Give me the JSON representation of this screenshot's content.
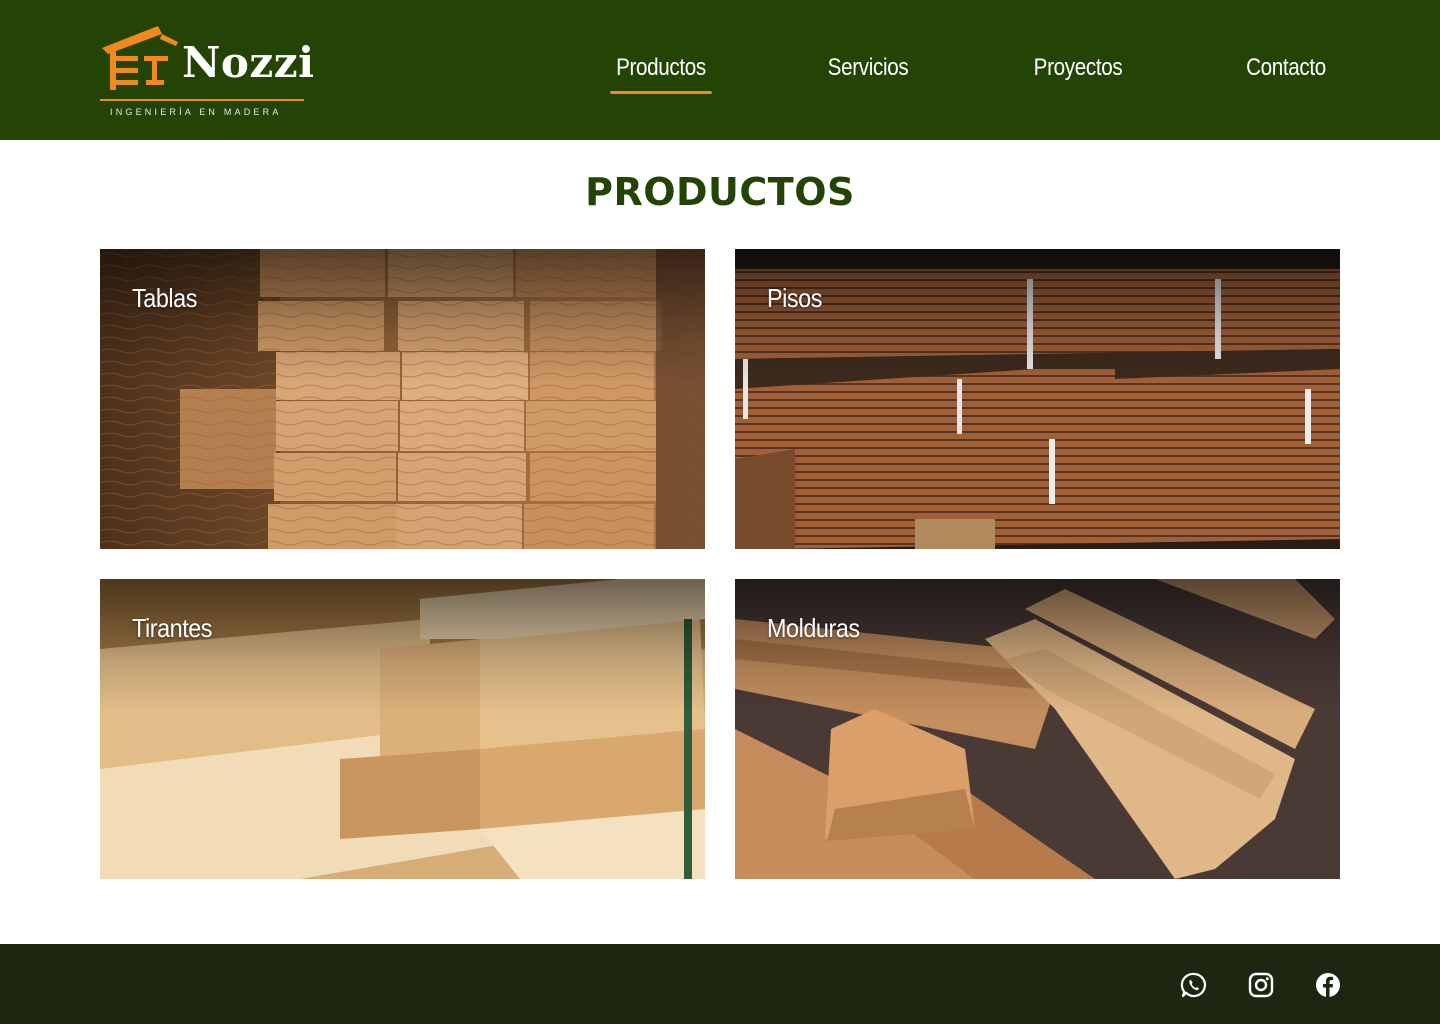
{
  "brand": {
    "name": "Nozzi",
    "tagline": "INGENIERÍA EN MADERA",
    "logo_icon": "roof-house-logo-icon",
    "accent_color": "#f08a1c",
    "header_color": "#244406",
    "footer_color": "#1c2610"
  },
  "nav": {
    "items": [
      {
        "label": "Productos",
        "active": true
      },
      {
        "label": "Servicios",
        "active": false
      },
      {
        "label": "Proyectos",
        "active": false
      },
      {
        "label": "Contacto",
        "active": false
      }
    ]
  },
  "main": {
    "title": "PRODUCTOS",
    "title_color": "#244406",
    "products": [
      {
        "label": "Tablas"
      },
      {
        "label": "Pisos"
      },
      {
        "label": "Tirantes"
      },
      {
        "label": "Molduras"
      }
    ]
  },
  "footer": {
    "social": [
      {
        "icon": "whatsapp-icon"
      },
      {
        "icon": "instagram-icon"
      },
      {
        "icon": "facebook-icon"
      }
    ]
  }
}
